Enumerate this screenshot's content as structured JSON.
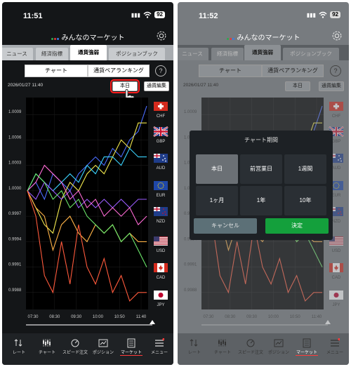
{
  "colors": {
    "accent_red": "#ff1e1e",
    "confirm_green": "#14a03c",
    "cancel_teal": "#5c7077"
  },
  "left": {
    "status_time": "11:51",
    "battery": "92"
  },
  "right": {
    "status_time": "11:52",
    "battery": "92"
  },
  "app_title": "みんなのマーケット",
  "tabs": [
    "ニュース",
    "経済指標",
    "通貨強弱",
    "ポジションブック"
  ],
  "active_tab": "通貨強弱",
  "segment": {
    "chart": "チャート",
    "ranking": "通貨ペアランキング"
  },
  "help": "?",
  "date": "2026/01/27 11:40",
  "period_button": "本日",
  "edit_button": "通貨編集",
  "currencies": [
    {
      "code": "CHF",
      "color": "#4a6cff"
    },
    {
      "code": "GBP",
      "color": "#f2e94e"
    },
    {
      "code": "AUD",
      "color": "#3bd4ff"
    },
    {
      "code": "EUR",
      "color": "#9b5cff"
    },
    {
      "code": "NZD",
      "color": "#ff6bd6"
    },
    {
      "code": "USD",
      "color": "#ffb347"
    },
    {
      "code": "CAD",
      "color": "#6be86b"
    },
    {
      "code": "JPY",
      "color": "#ff5a3c"
    }
  ],
  "chart_data": {
    "type": "line",
    "x": [
      "11:40"
    ],
    "x_ticks": [
      "07:30",
      "08:30",
      "09:30",
      "10:00",
      "10:50",
      "11:40"
    ],
    "y_ticks": [
      "1.0009",
      "1.0006",
      "1.0003",
      "1.0000",
      "0.9997",
      "0.9994",
      "0.9991",
      "0.9988"
    ],
    "ylim": [
      0.9986,
      1.0011
    ],
    "series": [
      {
        "name": "CHF",
        "values": [
          1.0,
          1.0001,
          0.9999,
          1.0002,
          1.0001,
          1.0,
          1.0002,
          1.0003,
          1.0004,
          1.0003,
          1.0005,
          1.0004,
          1.0006,
          1.0007,
          1.001
        ]
      },
      {
        "name": "GBP",
        "values": [
          1.0,
          0.9998,
          0.9996,
          0.9995,
          0.9999,
          1.0001,
          1.0,
          1.0002,
          1.0003,
          1.0002,
          1.0004,
          1.0006,
          1.0005,
          1.0008,
          1.0008
        ]
      },
      {
        "name": "AUD",
        "values": [
          1.0,
          1.0002,
          1.0001,
          1.0,
          1.0001,
          1.0002,
          1.0001,
          1.0003,
          1.0002,
          1.0004,
          1.0004,
          1.0003,
          1.0005,
          1.0004,
          1.0004
        ]
      },
      {
        "name": "EUR",
        "values": [
          1.0,
          0.9999,
          1.0001,
          1.0,
          0.9999,
          1.0,
          0.9998,
          0.9999,
          0.9998,
          0.9999,
          0.9998,
          0.9999,
          0.9998,
          0.9999,
          0.9999
        ]
      },
      {
        "name": "NZD",
        "values": [
          1.0,
          1.0001,
          1.0003,
          1.0002,
          1.0001,
          0.9999,
          1.0,
          0.9998,
          0.9999,
          0.9997,
          0.9998,
          0.9997,
          0.9998,
          0.9996,
          0.9997
        ]
      },
      {
        "name": "USD",
        "values": [
          1.0,
          0.9998,
          0.9997,
          0.9993,
          0.9996,
          0.9997,
          0.9995,
          0.9994,
          0.9996,
          0.9995,
          0.9996,
          0.9994,
          0.9995,
          0.9994,
          0.9994
        ]
      },
      {
        "name": "CAD",
        "values": [
          1.0,
          1.0002,
          1.0001,
          0.9999,
          1.0,
          0.9998,
          0.9999,
          0.9997,
          0.9996,
          0.9995,
          0.9996,
          0.9994,
          0.9995,
          0.9993,
          0.9991
        ]
      },
      {
        "name": "JPY",
        "values": [
          1.0,
          0.9997,
          0.999,
          0.9988,
          0.9994,
          0.9989,
          0.9996,
          0.9991,
          0.9989,
          0.9992,
          0.9988,
          0.999,
          0.9987,
          0.9988,
          0.9988
        ]
      }
    ]
  },
  "bottom_nav": [
    {
      "label": "レート",
      "icon": "arrows-icon"
    },
    {
      "label": "チャート",
      "icon": "candles-icon"
    },
    {
      "label": "スピード注文",
      "icon": "speed-icon"
    },
    {
      "label": "ポジション",
      "icon": "position-icon"
    },
    {
      "label": "マーケット",
      "icon": "market-icon"
    },
    {
      "label": "メニュー",
      "icon": "menu-icon"
    }
  ],
  "active_nav": "マーケット",
  "dialog": {
    "title": "チャート期間",
    "options": [
      "本日",
      "前営業日",
      "1週間",
      "1ヶ月",
      "1年",
      "10年"
    ],
    "selected": "本日",
    "cancel": "キャンセル",
    "confirm": "決定"
  }
}
